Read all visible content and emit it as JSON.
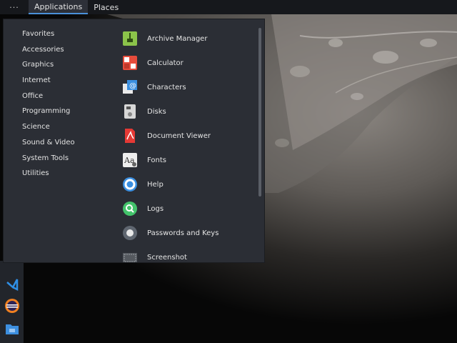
{
  "top_panel": {
    "menu_dots": "···",
    "applications": "Applications",
    "places": "Places"
  },
  "menu": {
    "categories": [
      "Favorites",
      "Accessories",
      "Graphics",
      "Internet",
      "Office",
      "Programming",
      "Science",
      "Sound & Video",
      "System Tools",
      "Utilities"
    ],
    "apps": [
      {
        "label": "Archive Manager",
        "icon": "archive-manager-icon"
      },
      {
        "label": "Calculator",
        "icon": "calculator-icon"
      },
      {
        "label": "Characters",
        "icon": "characters-icon"
      },
      {
        "label": "Disks",
        "icon": "disks-icon"
      },
      {
        "label": "Document Viewer",
        "icon": "document-viewer-icon"
      },
      {
        "label": "Fonts",
        "icon": "fonts-icon"
      },
      {
        "label": "Help",
        "icon": "help-icon"
      },
      {
        "label": "Logs",
        "icon": "logs-icon"
      },
      {
        "label": "Passwords and Keys",
        "icon": "passwords-keys-icon"
      },
      {
        "label": "Screenshot",
        "icon": "screenshot-icon"
      }
    ]
  },
  "dock": {
    "items": [
      "vscode-icon",
      "eclipse-icon",
      "files-icon"
    ]
  },
  "colors": {
    "panel": "#16181c",
    "menu_bg": "#2b2e35",
    "accent": "#4a90d9"
  }
}
